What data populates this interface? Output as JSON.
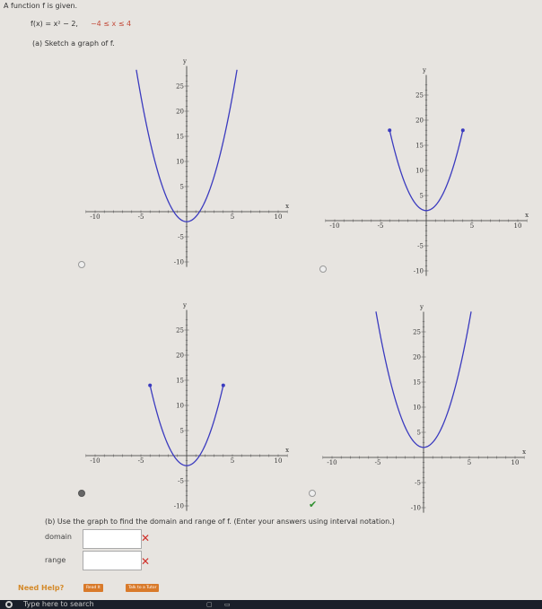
{
  "question": {
    "intro": "A function f is given.",
    "function": "f(x) = x² − 2,",
    "domain_text": "−4 ≤ x ≤ 4",
    "part_a": "(a) Sketch a graph of f.",
    "part_b": "(b) Use the graph to find the domain and range of f. (Enter your answers using interval notation.)"
  },
  "answers": {
    "domain_label": "domain",
    "range_label": "range",
    "domain_value": "",
    "range_value": "",
    "incorrect_icon": "x-mark-icon"
  },
  "graphs": [
    {
      "id": "option-1",
      "selected": false,
      "correct": false,
      "x_tick_labels": [
        "-10",
        "-5",
        "5",
        "10"
      ],
      "y_tick_labels": [
        "25",
        "20",
        "15",
        "10",
        "5",
        "-5",
        "-10"
      ],
      "x_axis_label": "x",
      "y_axis_label": "y"
    },
    {
      "id": "option-2",
      "selected": false,
      "correct": false,
      "x_tick_labels": [
        "-10",
        "-5",
        "5",
        "10"
      ],
      "y_tick_labels": [
        "25",
        "20",
        "15",
        "10",
        "5",
        "-5",
        "-10"
      ],
      "x_axis_label": "x",
      "y_axis_label": "y"
    },
    {
      "id": "option-3",
      "selected": true,
      "correct": false,
      "x_tick_labels": [
        "-10",
        "-5",
        "5",
        "10"
      ],
      "y_tick_labels": [
        "25",
        "20",
        "15",
        "10",
        "5",
        "-5",
        "-10"
      ],
      "x_axis_label": "x",
      "y_axis_label": "y"
    },
    {
      "id": "option-4",
      "selected": false,
      "correct": true,
      "x_tick_labels": [
        "-10",
        "-5",
        "5",
        "10"
      ],
      "y_tick_labels": [
        "25",
        "20",
        "15",
        "10",
        "5",
        "-5",
        "-10"
      ],
      "x_axis_label": "x",
      "y_axis_label": "y"
    }
  ],
  "help": {
    "need_help": "Need Help?",
    "read_it": "Read It",
    "talk_to_tutor": "Talk to a Tutor"
  },
  "taskbar": {
    "search_placeholder": "Type here to search"
  },
  "colors": {
    "curve": "#3b3bbf",
    "accent_red": "#d0302a",
    "help_orange": "#d97a2a",
    "correct_green": "#2f8f2f"
  }
}
